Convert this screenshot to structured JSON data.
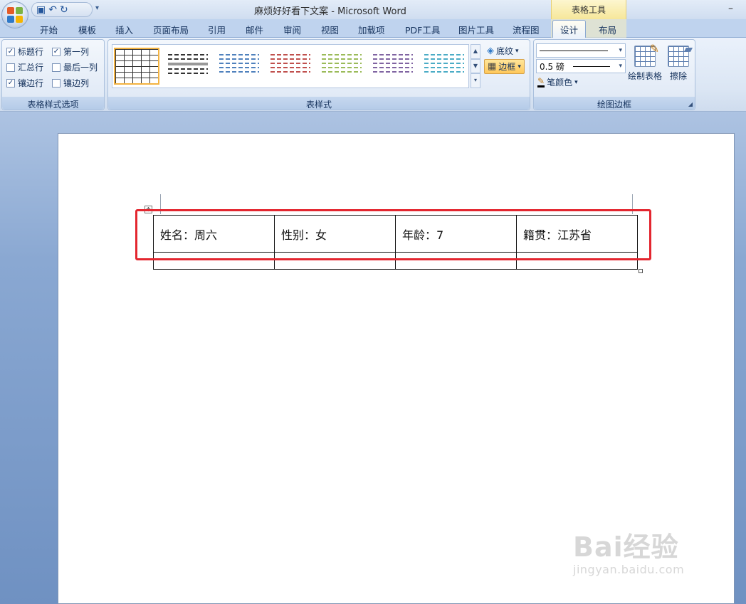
{
  "window": {
    "title": "麻烦好好看下文案 - Microsoft Word",
    "context_tab_group": "表格工具"
  },
  "quick_access": {
    "icons": [
      "save-icon",
      "undo-icon",
      "redo-icon",
      "customize-icon"
    ]
  },
  "tabs": [
    {
      "label": "开始"
    },
    {
      "label": "模板"
    },
    {
      "label": "插入"
    },
    {
      "label": "页面布局"
    },
    {
      "label": "引用"
    },
    {
      "label": "邮件"
    },
    {
      "label": "审阅"
    },
    {
      "label": "视图"
    },
    {
      "label": "加载项"
    },
    {
      "label": "PDF工具"
    },
    {
      "label": "图片工具"
    },
    {
      "label": "流程图"
    },
    {
      "label": "设计",
      "active": true
    },
    {
      "label": "布局"
    }
  ],
  "ribbon": {
    "table_style_options": {
      "label": "表格样式选项",
      "checkboxes": [
        {
          "label": "标题行",
          "checked": true
        },
        {
          "label": "第一列",
          "checked": true
        },
        {
          "label": "汇总行",
          "checked": false
        },
        {
          "label": "最后一列",
          "checked": false
        },
        {
          "label": "镶边行",
          "checked": true
        },
        {
          "label": "镶边列",
          "checked": false
        }
      ]
    },
    "table_styles": {
      "label": "表样式",
      "swatch_colors": [
        "#222222",
        "#333333",
        "#4f81bd",
        "#c0504d",
        "#9bbb59",
        "#8064a2",
        "#4bacc6"
      ],
      "shading_label": "底纹",
      "borders_label": "边框"
    },
    "draw_borders": {
      "label": "绘图边框",
      "pen_weight": "0.5 磅",
      "pen_color_label": "笔颜色",
      "draw_table_label": "绘制表格",
      "eraser_label": "擦除"
    }
  },
  "document": {
    "table_rows": [
      [
        "姓名：周六",
        "性别：女",
        "年龄：7",
        "籍贯：江苏省"
      ],
      [
        "",
        "",
        "",
        ""
      ]
    ]
  },
  "watermark": {
    "brand": "Bai经验",
    "url": "jingyan.baidu.com"
  },
  "colors": {
    "highlight_box": "#e3262f",
    "active_tab": "#fffdf1",
    "context_tab": "#f6e79a"
  }
}
